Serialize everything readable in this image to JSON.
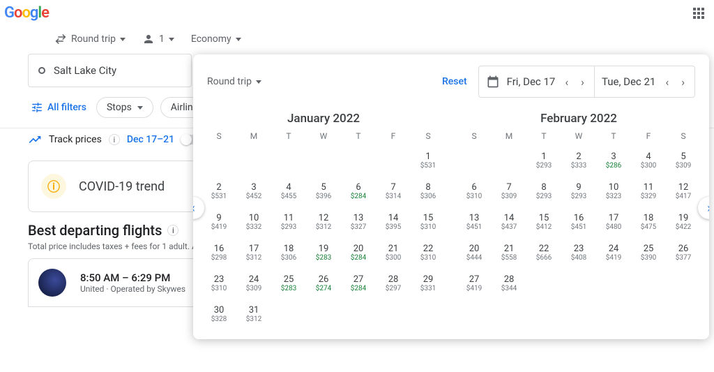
{
  "header": {
    "logo_chars": [
      "G",
      "o",
      "o",
      "g",
      "l",
      "e"
    ]
  },
  "controls": {
    "trip_type": "Round trip",
    "passengers": "1",
    "cabin": "Economy"
  },
  "origin": "Salt Lake City",
  "filters": {
    "all": "All filters",
    "stops": "Stops",
    "airlines": "Airlin"
  },
  "track": {
    "label": "Track prices",
    "date_range": "Dec 17–21"
  },
  "covid": {
    "label": "COVID-19 trend"
  },
  "best": {
    "heading": "Best departing flights",
    "sub": "Total price includes taxes + fees for 1 adult. A"
  },
  "flight": {
    "time": "8:50 AM – 6:29 PM",
    "op": "United · Operated by Skywes"
  },
  "popup": {
    "trip_type": "Round trip",
    "reset": "Reset",
    "depart": "Fri, Dec 17",
    "ret": "Tue, Dec 21"
  },
  "months": [
    {
      "title": "January 2022",
      "dow": [
        "S",
        "M",
        "T",
        "W",
        "T",
        "F",
        "S"
      ],
      "pad": 6,
      "days": [
        {
          "d": 1,
          "p": "$531"
        },
        {
          "d": 2,
          "p": "$531"
        },
        {
          "d": 3,
          "p": "$452"
        },
        {
          "d": 4,
          "p": "$455"
        },
        {
          "d": 5,
          "p": "$396"
        },
        {
          "d": 6,
          "p": "$284",
          "g": true
        },
        {
          "d": 7,
          "p": "$314"
        },
        {
          "d": 8,
          "p": "$306"
        },
        {
          "d": 9,
          "p": "$419"
        },
        {
          "d": 10,
          "p": "$332"
        },
        {
          "d": 11,
          "p": "$293"
        },
        {
          "d": 12,
          "p": "$312"
        },
        {
          "d": 13,
          "p": "$327"
        },
        {
          "d": 14,
          "p": "$395"
        },
        {
          "d": 15,
          "p": "$310"
        },
        {
          "d": 16,
          "p": "$298"
        },
        {
          "d": 17,
          "p": "$312"
        },
        {
          "d": 18,
          "p": "$306"
        },
        {
          "d": 19,
          "p": "$283",
          "g": true
        },
        {
          "d": 20,
          "p": "$284",
          "g": true
        },
        {
          "d": 21,
          "p": "$300"
        },
        {
          "d": 22,
          "p": "$310"
        },
        {
          "d": 23,
          "p": "$310"
        },
        {
          "d": 24,
          "p": "$309"
        },
        {
          "d": 25,
          "p": "$283",
          "g": true
        },
        {
          "d": 26,
          "p": "$274",
          "g": true
        },
        {
          "d": 27,
          "p": "$284",
          "g": true
        },
        {
          "d": 28,
          "p": "$297"
        },
        {
          "d": 29,
          "p": "$331"
        },
        {
          "d": 30,
          "p": "$328"
        },
        {
          "d": 31,
          "p": "$312"
        }
      ]
    },
    {
      "title": "February 2022",
      "dow": [
        "S",
        "M",
        "T",
        "W",
        "T",
        "F",
        "S"
      ],
      "pad": 2,
      "days": [
        {
          "d": 1,
          "p": "$293"
        },
        {
          "d": 2,
          "p": "$333"
        },
        {
          "d": 3,
          "p": "$286",
          "g": true
        },
        {
          "d": 4,
          "p": "$300"
        },
        {
          "d": 5,
          "p": "$309"
        },
        {
          "d": 6,
          "p": "$310"
        },
        {
          "d": 7,
          "p": "$309"
        },
        {
          "d": 8,
          "p": "$293"
        },
        {
          "d": 9,
          "p": "$293"
        },
        {
          "d": 10,
          "p": "$323"
        },
        {
          "d": 11,
          "p": "$329"
        },
        {
          "d": 12,
          "p": "$417"
        },
        {
          "d": 13,
          "p": "$451"
        },
        {
          "d": 14,
          "p": "$437"
        },
        {
          "d": 15,
          "p": "$412"
        },
        {
          "d": 16,
          "p": "$451"
        },
        {
          "d": 17,
          "p": "$480"
        },
        {
          "d": 18,
          "p": "$475"
        },
        {
          "d": 19,
          "p": "$422"
        },
        {
          "d": 20,
          "p": "$444"
        },
        {
          "d": 21,
          "p": "$558"
        },
        {
          "d": 22,
          "p": "$666"
        },
        {
          "d": 23,
          "p": "$408"
        },
        {
          "d": 24,
          "p": "$419"
        },
        {
          "d": 25,
          "p": "$390"
        },
        {
          "d": 26,
          "p": "$377"
        },
        {
          "d": 27,
          "p": "$419"
        },
        {
          "d": 28,
          "p": "$344"
        }
      ]
    }
  ]
}
